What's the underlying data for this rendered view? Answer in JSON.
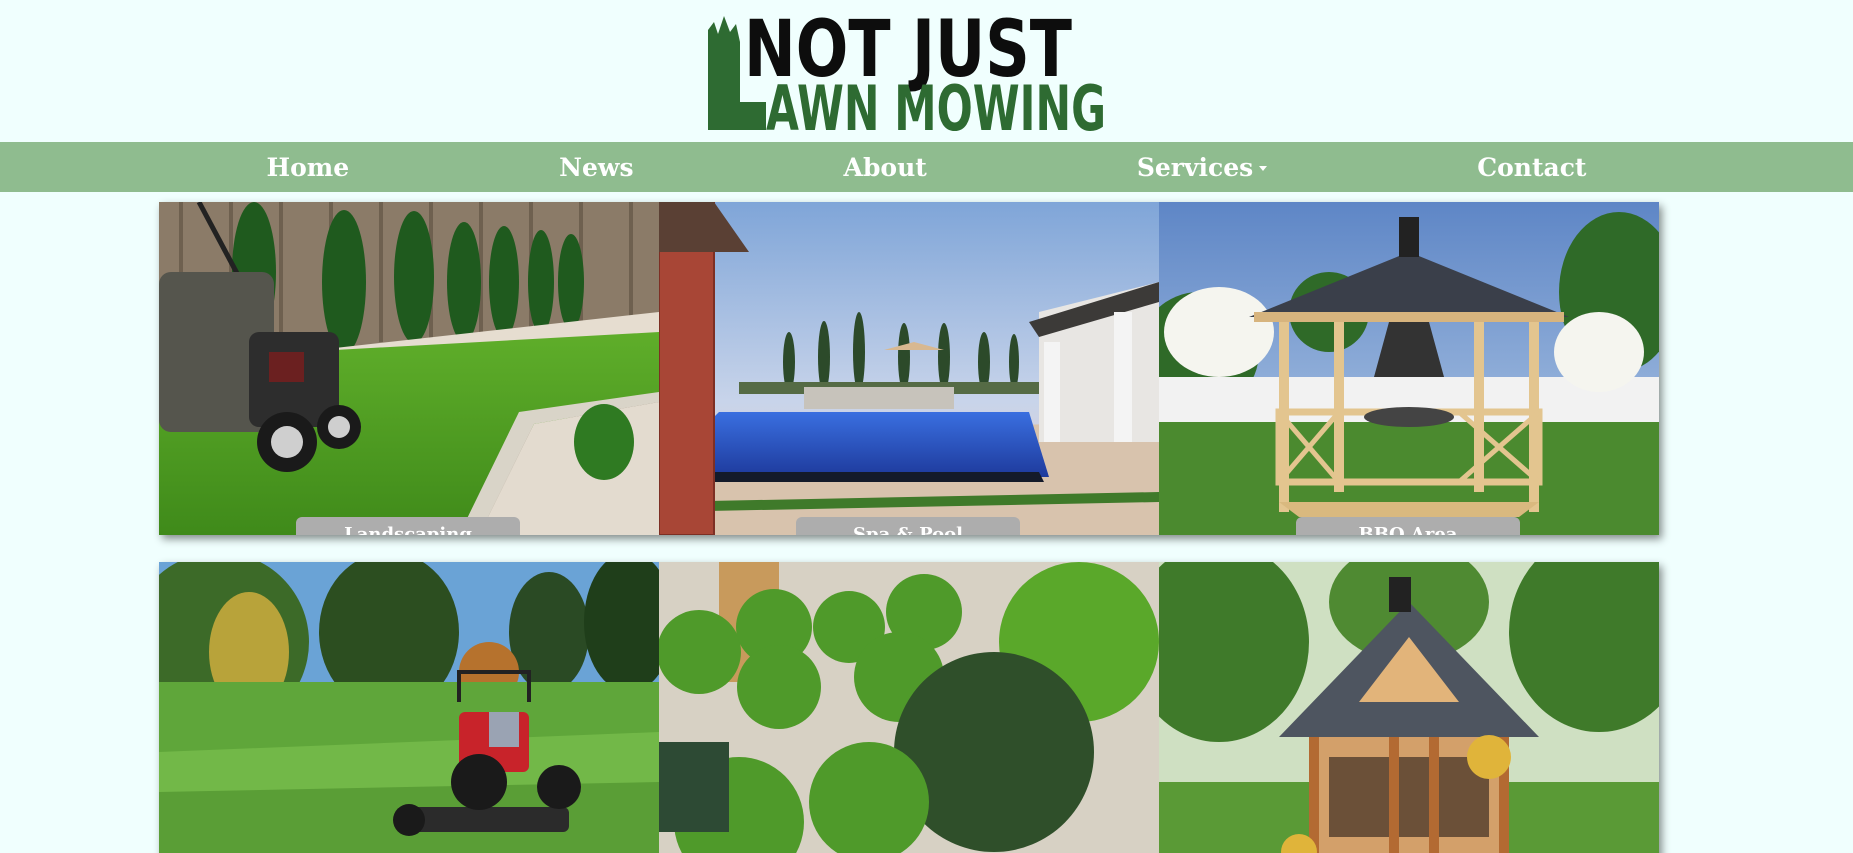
{
  "brand": {
    "logo_line1": "NOT JUST",
    "logo_line2": "AWN MOWING",
    "logo_initial": "L",
    "colors": {
      "logo_dark": "#0d0d0d",
      "logo_green": "#2e6b32"
    }
  },
  "nav": {
    "items": [
      {
        "label": "Home"
      },
      {
        "label": "News"
      },
      {
        "label": "About"
      },
      {
        "label": "Services",
        "has_dropdown": true
      },
      {
        "label": "Contact"
      }
    ],
    "colors": {
      "background": "#8fbc8f",
      "text": "#ffffff"
    }
  },
  "gallery": {
    "tiles": [
      {
        "caption": "Landscaping",
        "image": "lawn-mower-on-striped-lawn"
      },
      {
        "caption": "Spa & Pool",
        "image": "backyard-pool-at-dusk"
      },
      {
        "caption": "BBQ Area",
        "image": "wooden-gazebo-with-grill"
      },
      {
        "caption": "",
        "image": "golf-course-mower"
      },
      {
        "caption": "",
        "image": "topiary-boxwood-balls"
      },
      {
        "caption": "",
        "image": "bbq-hut-in-garden"
      }
    ],
    "caption_bg": "#adadad"
  },
  "page_bg": "#f0fffe"
}
